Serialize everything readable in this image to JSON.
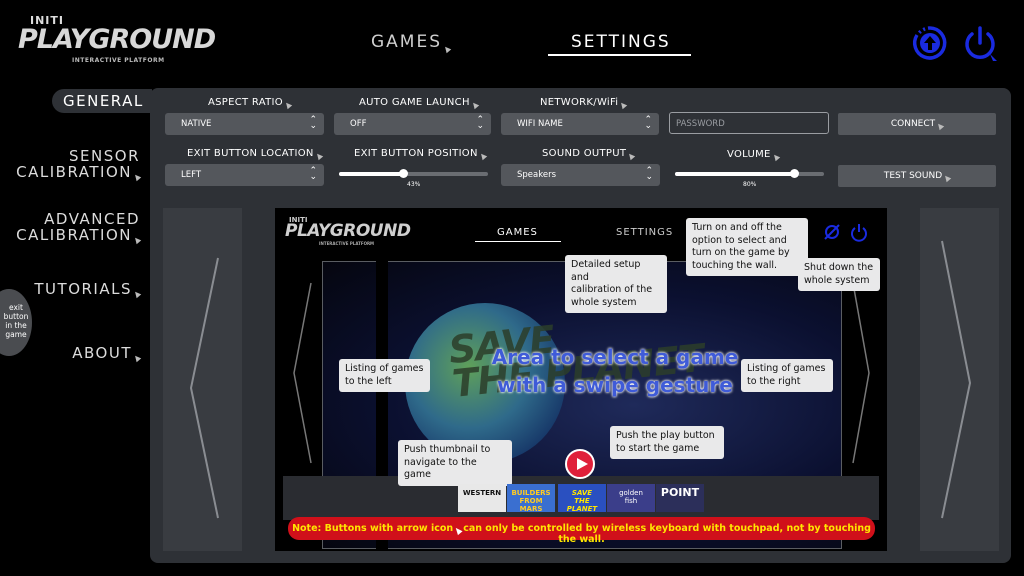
{
  "logo": {
    "small": "INITI",
    "title": "PLAYGROUND",
    "subtitle": "INTERACTIVE PLATFORM"
  },
  "top_tabs": {
    "games": "GAMES",
    "settings": "SETTINGS",
    "active": "settings"
  },
  "top_icons": [
    "update-icon",
    "power-icon"
  ],
  "sidebar": {
    "items": [
      {
        "label": "GENERAL",
        "active": true
      },
      {
        "label": "SENSOR\nCALIBRATION"
      },
      {
        "label": "ADVANCED\nCALIBRATION"
      },
      {
        "label": "TUTORIALS"
      },
      {
        "label": "ABOUT"
      }
    ],
    "exit_bubble": "exit\nbutton\nin the\ngame"
  },
  "settings": {
    "aspect_ratio": {
      "label": "ASPECT RATIO",
      "value": "NATIVE"
    },
    "auto_game_launch": {
      "label": "AUTO GAME LAUNCH",
      "value": "OFF"
    },
    "network": {
      "label": "NETWORK/WiFi",
      "value": "WIFI NAME",
      "password_placeholder": "PASSWORD",
      "connect": "CONNECT"
    },
    "exit_button_location": {
      "label": "EXIT BUTTON LOCATION",
      "value": "LEFT"
    },
    "exit_button_position": {
      "label": "EXIT BUTTON POSITION",
      "value_text": "43%",
      "value": 0.43
    },
    "sound_output": {
      "label": "SOUND OUTPUT",
      "value": "Speakers"
    },
    "volume": {
      "label": "VOLUME",
      "value_text": "80%",
      "value": 0.8,
      "test_sound": "TEST SOUND"
    }
  },
  "preview": {
    "logo_small": "INITI",
    "logo": "PLAYGROUND",
    "logo_sub": "INTERACTIVE PLATFORM",
    "tab_games": "GAMES",
    "tab_settings": "SETTINGS",
    "callouts": {
      "settings": "Detailed setup and\ncalibration of the\nwhole system",
      "turn_on": "Turn on and off the\noption to select and\nturn on the game by\ntouching the wall.",
      "shutdown": "Shut down the\nwhole system",
      "left": "Listing of games\nto the left",
      "right": "Listing of games\nto the right",
      "thumbnail": "Push thumbnail to\nnavigate to the game",
      "play": "Push the play button\nto start the game"
    },
    "game_title": "SAVE\nTHE PLANET",
    "overlay": "Area to select a game\nwith a swipe gesture",
    "thumbnails": [
      {
        "label": "WESTERN",
        "color": "#e8e8e8"
      },
      {
        "label": "BUILDERS\nFROM MARS",
        "color": "#3a6fd0"
      },
      {
        "label": "SAVE\nTHE PLANET",
        "color": "#2a50c0"
      },
      {
        "label": "golden\nfish",
        "color": "#3b3e8a"
      },
      {
        "label": "POINT",
        "color": "#2c2f5a"
      }
    ],
    "note_prefix": "Note: Buttons with arrow icon",
    "note_suffix": "can only be controlled by wireless keyboard with touchpad, not by touching the wall."
  },
  "colors": {
    "accent_blue": "#1a2be0",
    "note_red": "#d0101a",
    "note_text": "#ffe600",
    "panel": "#2e3136"
  }
}
